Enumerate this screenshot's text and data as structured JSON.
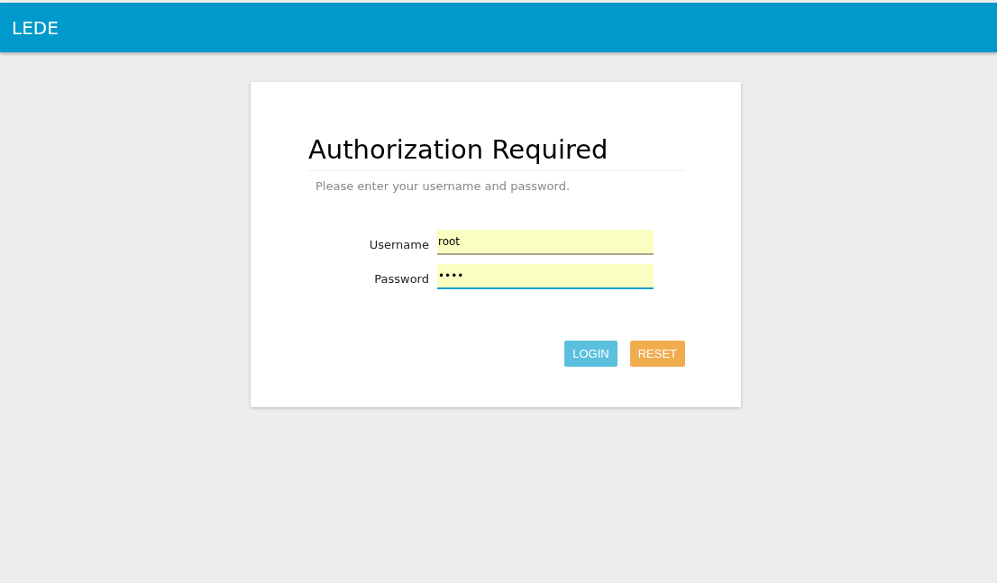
{
  "header": {
    "brand": "LEDE"
  },
  "login": {
    "title": "Authorization Required",
    "description": "Please enter your username and password.",
    "fields": [
      {
        "label": "Username",
        "value": "root",
        "focused": false
      },
      {
        "label": "Password",
        "value": "••••",
        "focused": true
      }
    ],
    "buttons": [
      {
        "label": "LOGIN",
        "kind": "primary"
      },
      {
        "label": "RESET",
        "kind": "reset"
      }
    ]
  }
}
